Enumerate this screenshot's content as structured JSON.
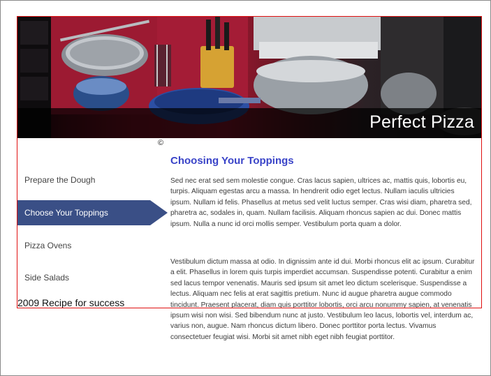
{
  "header": {
    "title": "Perfect Pizza",
    "image_alt": "kitchen utensils and mixer"
  },
  "copyright_symbol": "©",
  "nav": {
    "items": [
      {
        "label": "Prepare the Dough",
        "active": false
      },
      {
        "label": "Choose Your Toppings",
        "active": true
      },
      {
        "label": "Pizza Ovens",
        "active": false
      },
      {
        "label": "Side Salads",
        "active": false
      }
    ]
  },
  "footer_tagline": "2009 Recipe for success",
  "content": {
    "heading": "Choosing Your Toppings",
    "paragraphs": [
      "Sed nec erat sed sem molestie congue. Cras lacus sapien, ultrices ac, mattis quis, lobortis eu, turpis. Aliquam egestas arcu a massa. In hendrerit odio eget lectus. Nullam iaculis ultricies ipsum. Nullam id felis. Phasellus at metus sed velit luctus semper. Cras wisi diam, pharetra sed, pharetra ac, sodales in, quam. Nullam facilisis. Aliquam rhoncus sapien ac dui. Donec mattis ipsum. Nulla a nunc id orci mollis semper. Vestibulum porta quam a dolor.",
      "Vestibulum dictum massa at odio. In dignissim ante id dui. Morbi rhoncus elit ac ipsum. Curabitur a elit. Phasellus in lorem quis turpis imperdiet accumsan. Suspendisse potenti. Curabitur a enim sed lacus tempor venenatis. Mauris sed ipsum sit amet leo dictum scelerisque. Suspendisse a lectus. Aliquam nec felis at erat sagittis pretium. Nunc id augue pharetra augue commodo tincidunt. Praesent placerat, diam quis porttitor lobortis, orci arcu nonummy sapien, at venenatis ipsum wisi non wisi. Sed bibendum nunc at justo. Vestibulum leo lacus, lobortis vel, interdum ac, varius non, augue. Nam rhoncus dictum libero. Donec porttitor porta lectus. Vivamus consectetuer feugiat wisi. Morbi sit amet nibh eget nibh feugiat porttitor."
    ]
  },
  "colors": {
    "heading": "#3a44c8",
    "nav_active_bg": "#3a4f86",
    "container_border": "#e01010"
  }
}
